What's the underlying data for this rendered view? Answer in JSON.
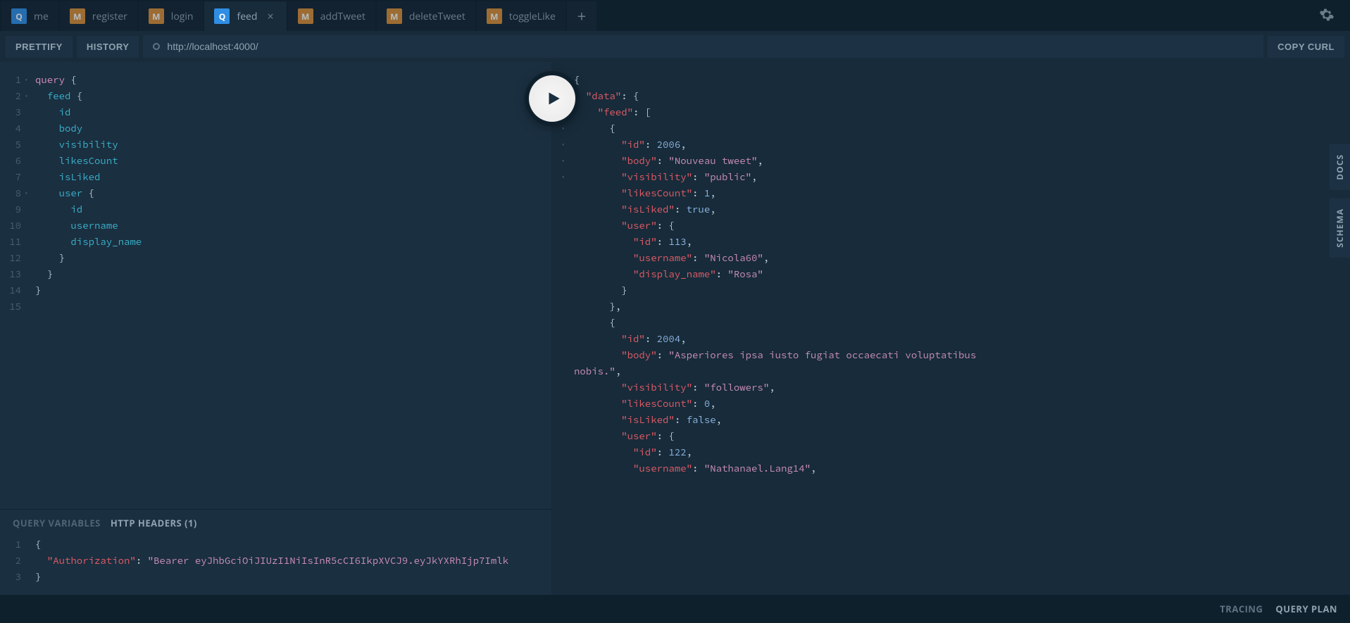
{
  "tabs": [
    {
      "type": "Q",
      "label": "me"
    },
    {
      "type": "M",
      "label": "register"
    },
    {
      "type": "M",
      "label": "login"
    },
    {
      "type": "Q",
      "label": "feed",
      "active": true
    },
    {
      "type": "M",
      "label": "addTweet"
    },
    {
      "type": "M",
      "label": "deleteTweet"
    },
    {
      "type": "M",
      "label": "toggleLike"
    }
  ],
  "toolbar": {
    "prettify_label": "PRETTIFY",
    "history_label": "HISTORY",
    "copy_curl_label": "COPY CURL",
    "endpoint": "http://localhost:4000/"
  },
  "query_lines": [
    {
      "n": 1,
      "fold": true,
      "tokens": [
        [
          "keyword",
          "query"
        ],
        [
          "punc",
          " {"
        ]
      ]
    },
    {
      "n": 2,
      "fold": true,
      "tokens": [
        [
          "plain",
          "  "
        ],
        [
          "def",
          "feed"
        ],
        [
          "punc",
          " {"
        ]
      ]
    },
    {
      "n": 3,
      "tokens": [
        [
          "plain",
          "    "
        ],
        [
          "attr",
          "id"
        ]
      ]
    },
    {
      "n": 4,
      "tokens": [
        [
          "plain",
          "    "
        ],
        [
          "attr",
          "body"
        ]
      ]
    },
    {
      "n": 5,
      "tokens": [
        [
          "plain",
          "    "
        ],
        [
          "attr",
          "visibility"
        ]
      ]
    },
    {
      "n": 6,
      "tokens": [
        [
          "plain",
          "    "
        ],
        [
          "attr",
          "likesCount"
        ]
      ]
    },
    {
      "n": 7,
      "tokens": [
        [
          "plain",
          "    "
        ],
        [
          "attr",
          "isLiked"
        ]
      ]
    },
    {
      "n": 8,
      "fold": true,
      "tokens": [
        [
          "plain",
          "    "
        ],
        [
          "def",
          "user"
        ],
        [
          "punc",
          " {"
        ]
      ]
    },
    {
      "n": 9,
      "tokens": [
        [
          "plain",
          "      "
        ],
        [
          "attr",
          "id"
        ]
      ]
    },
    {
      "n": 10,
      "tokens": [
        [
          "plain",
          "      "
        ],
        [
          "attr",
          "username"
        ]
      ]
    },
    {
      "n": 11,
      "tokens": [
        [
          "plain",
          "      "
        ],
        [
          "attr",
          "display_name"
        ]
      ]
    },
    {
      "n": 12,
      "tokens": [
        [
          "plain",
          "    "
        ],
        [
          "punc",
          "}"
        ]
      ]
    },
    {
      "n": 13,
      "tokens": [
        [
          "plain",
          "  "
        ],
        [
          "punc",
          "}"
        ]
      ]
    },
    {
      "n": 14,
      "tokens": [
        [
          "punc",
          "}"
        ]
      ]
    },
    {
      "n": 15,
      "tokens": [
        [
          "plain",
          ""
        ]
      ]
    }
  ],
  "vars_tabs": {
    "variables_label": "QUERY VARIABLES",
    "headers_label": "HTTP HEADERS (1)"
  },
  "headers_lines": [
    {
      "n": 1,
      "tokens": [
        [
          "punc",
          "{"
        ]
      ]
    },
    {
      "n": 2,
      "tokens": [
        [
          "plain",
          "  "
        ],
        [
          "keyred",
          "\"Authorization\""
        ],
        [
          "punc",
          ": "
        ],
        [
          "jstr",
          "\"Bearer eyJhbGciOiJIUzI1NiIsInR5cCI6IkpXVCJ9.eyJkYXRhIjp7Imlk"
        ]
      ]
    },
    {
      "n": 3,
      "tokens": [
        [
          "punc",
          "}"
        ]
      ]
    }
  ],
  "response_lines": [
    {
      "fold": true,
      "pad": 0,
      "tokens": [
        [
          "punc",
          "{"
        ]
      ]
    },
    {
      "fold": true,
      "pad": 2,
      "tokens": [
        [
          "key",
          "\"data\""
        ],
        [
          "punc",
          ": {"
        ]
      ]
    },
    {
      "fold": true,
      "pad": 4,
      "tokens": [
        [
          "key",
          "\"feed\""
        ],
        [
          "punc",
          ": ["
        ]
      ]
    },
    {
      "fold": true,
      "pad": 6,
      "tokens": [
        [
          "punc",
          "{"
        ]
      ]
    },
    {
      "pad": 8,
      "tokens": [
        [
          "key",
          "\"id\""
        ],
        [
          "punc",
          ": "
        ],
        [
          "num",
          "2006"
        ],
        [
          "punc",
          ","
        ]
      ]
    },
    {
      "pad": 8,
      "tokens": [
        [
          "key",
          "\"body\""
        ],
        [
          "punc",
          ": "
        ],
        [
          "str",
          "\"Nouveau tweet\""
        ],
        [
          "punc",
          ","
        ]
      ]
    },
    {
      "pad": 8,
      "tokens": [
        [
          "key",
          "\"visibility\""
        ],
        [
          "punc",
          ": "
        ],
        [
          "str",
          "\"public\""
        ],
        [
          "punc",
          ","
        ]
      ]
    },
    {
      "pad": 8,
      "tokens": [
        [
          "key",
          "\"likesCount\""
        ],
        [
          "punc",
          ": "
        ],
        [
          "num",
          "1"
        ],
        [
          "punc",
          ","
        ]
      ]
    },
    {
      "pad": 8,
      "tokens": [
        [
          "key",
          "\"isLiked\""
        ],
        [
          "punc",
          ": "
        ],
        [
          "bool",
          "true"
        ],
        [
          "punc",
          ","
        ]
      ]
    },
    {
      "fold": true,
      "pad": 8,
      "tokens": [
        [
          "key",
          "\"user\""
        ],
        [
          "punc",
          ": {"
        ]
      ]
    },
    {
      "pad": 10,
      "tokens": [
        [
          "key",
          "\"id\""
        ],
        [
          "punc",
          ": "
        ],
        [
          "num",
          "113"
        ],
        [
          "punc",
          ","
        ]
      ]
    },
    {
      "pad": 10,
      "tokens": [
        [
          "key",
          "\"username\""
        ],
        [
          "punc",
          ": "
        ],
        [
          "str",
          "\"Nicola60\""
        ],
        [
          "punc",
          ","
        ]
      ]
    },
    {
      "pad": 10,
      "tokens": [
        [
          "key",
          "\"display_name\""
        ],
        [
          "punc",
          ": "
        ],
        [
          "str",
          "\"Rosa\""
        ]
      ]
    },
    {
      "pad": 8,
      "tokens": [
        [
          "punc",
          "}"
        ]
      ]
    },
    {
      "pad": 6,
      "tokens": [
        [
          "punc",
          "},"
        ]
      ]
    },
    {
      "fold": true,
      "pad": 6,
      "tokens": [
        [
          "punc",
          "{"
        ]
      ]
    },
    {
      "pad": 8,
      "tokens": [
        [
          "key",
          "\"id\""
        ],
        [
          "punc",
          ": "
        ],
        [
          "num",
          "2004"
        ],
        [
          "punc",
          ","
        ]
      ]
    },
    {
      "pad": 8,
      "tokens": [
        [
          "key",
          "\"body\""
        ],
        [
          "punc",
          ": "
        ],
        [
          "str",
          "\"Asperiores ipsa iusto fugiat occaecati voluptatibus"
        ]
      ]
    },
    {
      "pad": 0,
      "tokens": [
        [
          "str",
          "nobis.\""
        ],
        [
          "punc",
          ","
        ]
      ]
    },
    {
      "pad": 8,
      "tokens": [
        [
          "key",
          "\"visibility\""
        ],
        [
          "punc",
          ": "
        ],
        [
          "str",
          "\"followers\""
        ],
        [
          "punc",
          ","
        ]
      ]
    },
    {
      "pad": 8,
      "tokens": [
        [
          "key",
          "\"likesCount\""
        ],
        [
          "punc",
          ": "
        ],
        [
          "num",
          "0"
        ],
        [
          "punc",
          ","
        ]
      ]
    },
    {
      "pad": 8,
      "tokens": [
        [
          "key",
          "\"isLiked\""
        ],
        [
          "punc",
          ": "
        ],
        [
          "bool",
          "false"
        ],
        [
          "punc",
          ","
        ]
      ]
    },
    {
      "fold": true,
      "pad": 8,
      "tokens": [
        [
          "key",
          "\"user\""
        ],
        [
          "punc",
          ": {"
        ]
      ]
    },
    {
      "pad": 10,
      "tokens": [
        [
          "key",
          "\"id\""
        ],
        [
          "punc",
          ": "
        ],
        [
          "num",
          "122"
        ],
        [
          "punc",
          ","
        ]
      ]
    },
    {
      "pad": 10,
      "tokens": [
        [
          "key",
          "\"username\""
        ],
        [
          "punc",
          ": "
        ],
        [
          "str",
          "\"Nathanael.Lang14\""
        ],
        [
          "punc",
          ","
        ]
      ]
    }
  ],
  "side_tabs": {
    "docs": "DOCS",
    "schema": "SCHEMA"
  },
  "bottom": {
    "tracing": "TRACING",
    "query_plan": "QUERY PLAN"
  }
}
